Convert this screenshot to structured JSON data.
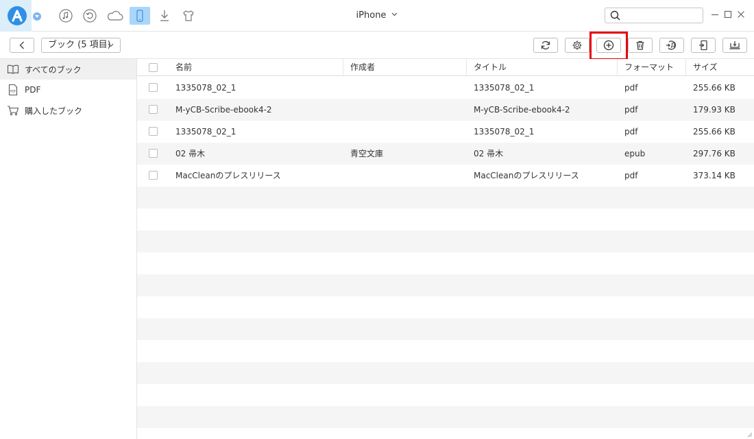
{
  "titlebar": {
    "device_name": "iPhone",
    "search": {
      "value": "",
      "placeholder": ""
    },
    "top_icons": [
      "music-icon",
      "restore-icon",
      "cloud-icon",
      "device-icon",
      "download-icon",
      "shirt-icon"
    ]
  },
  "toolbar": {
    "category_label": "ブック (5 項目)",
    "buttons": [
      "refresh-icon",
      "settings-icon",
      "add-icon",
      "trash-icon",
      "to-itunes-icon",
      "to-device-icon",
      "to-computer-icon"
    ]
  },
  "sidebar": {
    "items": [
      {
        "label": "すべてのブック",
        "icon": "book-icon",
        "active": true
      },
      {
        "label": "PDF",
        "icon": "pdf-icon",
        "active": false
      },
      {
        "label": "購入したブック",
        "icon": "cart-icon",
        "active": false
      }
    ]
  },
  "table": {
    "columns": [
      "名前",
      "作成者",
      "タイトル",
      "フォーマット",
      "サイズ"
    ],
    "rows": [
      {
        "name": "1335078_02_1",
        "author": "",
        "title": "1335078_02_1",
        "format": "pdf",
        "size": "255.66 KB"
      },
      {
        "name": "M-yCB-Scribe-ebook4-2",
        "author": "",
        "title": "M-yCB-Scribe-ebook4-2",
        "format": "pdf",
        "size": "179.93 KB"
      },
      {
        "name": "1335078_02_1",
        "author": "",
        "title": "1335078_02_1",
        "format": "pdf",
        "size": "255.66 KB"
      },
      {
        "name": "02 帚木",
        "author": "青空文庫",
        "title": "02 帚木",
        "format": "epub",
        "size": "297.76 KB"
      },
      {
        "name": "MacCleanのプレスリリース",
        "author": "",
        "title": "MacCleanのプレスリリース",
        "format": "pdf",
        "size": "373.14 KB"
      }
    ]
  },
  "colors": {
    "accent": "#2f8fe6",
    "highlight": "#e8000b",
    "active_icon_bg": "#a9d6fb"
  }
}
